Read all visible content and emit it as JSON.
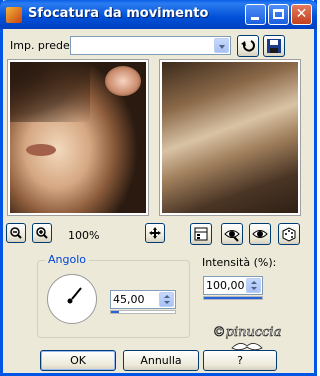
{
  "window": {
    "title": "Sfocatura da movimento",
    "colors": {
      "titlebar": "#0055e5",
      "accent": "#2b63d8",
      "legend": "#0046d5"
    }
  },
  "titlebar_buttons": {
    "minimize": "minimize-icon",
    "maximize": "maximize-icon",
    "close": "close-icon"
  },
  "preset": {
    "label": "Imp. predef.:",
    "value": ""
  },
  "toolbar_icons": {
    "reset": "reset-icon",
    "save": "save-preset-icon"
  },
  "zoom": {
    "zoom_out": "zoom-out-icon",
    "zoom_in": "zoom-in-icon",
    "level": "100%"
  },
  "view_icons": [
    "move-icon",
    "preview-toggle-icon",
    "proof-icon",
    "auto-proof-icon",
    "randomize-icon"
  ],
  "angle": {
    "legend": "Angolo",
    "value": "45,00",
    "slider_fraction": 0.125
  },
  "intensity": {
    "label": "Intensità (%):",
    "value": "100,00",
    "slider_fraction": 1.0
  },
  "buttons": {
    "ok": "OK",
    "cancel": "Annulla",
    "help": "?"
  },
  "watermark": {
    "text": "©pinuccia"
  }
}
